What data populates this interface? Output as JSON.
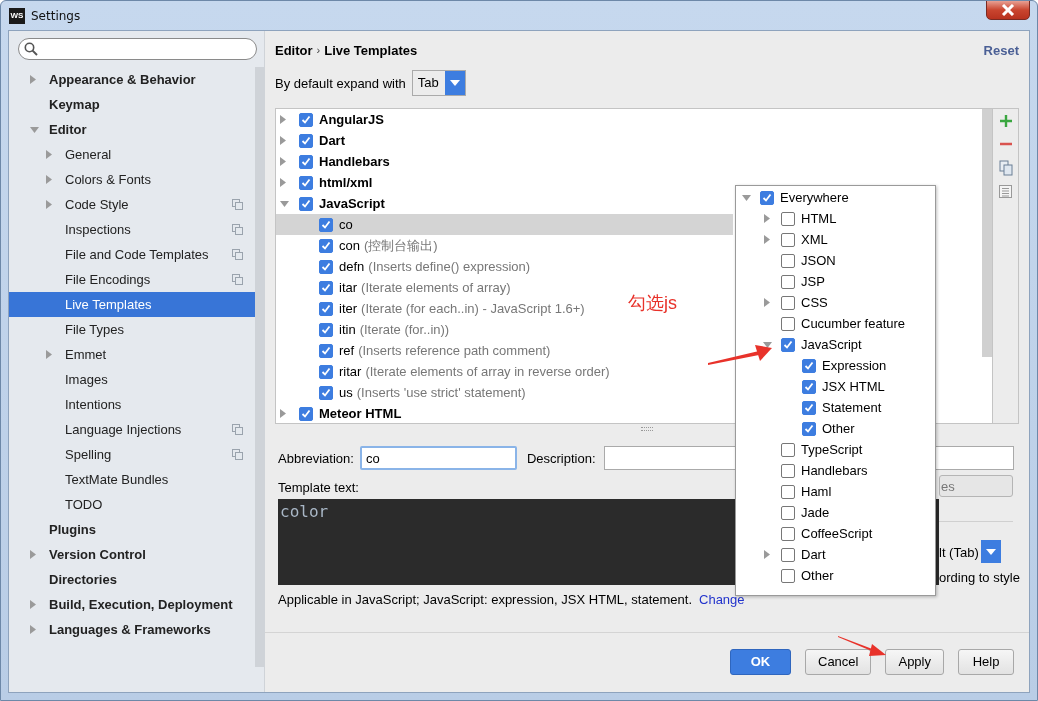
{
  "window": {
    "title": "Settings",
    "logo": "WS"
  },
  "sidebar": {
    "items": [
      {
        "label": "Appearance & Behavior",
        "expanded": false
      },
      {
        "label": "Keymap"
      },
      {
        "label": "Editor",
        "expanded": true,
        "children": [
          {
            "label": "General",
            "expanded": false
          },
          {
            "label": "Colors & Fonts",
            "expanded": false
          },
          {
            "label": "Code Style",
            "expanded": false,
            "project": true
          },
          {
            "label": "Inspections",
            "project": true
          },
          {
            "label": "File and Code Templates",
            "project": true
          },
          {
            "label": "File Encodings",
            "project": true
          },
          {
            "label": "Live Templates",
            "selected": true
          },
          {
            "label": "File Types"
          },
          {
            "label": "Emmet",
            "expanded": false
          },
          {
            "label": "Images"
          },
          {
            "label": "Intentions"
          },
          {
            "label": "Language Injections",
            "project": true
          },
          {
            "label": "Spelling",
            "project": true
          },
          {
            "label": "TextMate Bundles"
          },
          {
            "label": "TODO"
          }
        ]
      },
      {
        "label": "Plugins"
      },
      {
        "label": "Version Control",
        "expanded": false
      },
      {
        "label": "Directories"
      },
      {
        "label": "Build, Execution, Deployment",
        "expanded": false
      },
      {
        "label": "Languages & Frameworks",
        "expanded": false
      }
    ]
  },
  "header": {
    "breadcrumb": [
      "Editor",
      "Live Templates"
    ],
    "separator": "›",
    "reset": "Reset"
  },
  "expand_with": {
    "label": "By default expand with",
    "value": "Tab"
  },
  "templates": [
    {
      "name": "AngularJS",
      "checked": true,
      "expanded": false
    },
    {
      "name": "Dart",
      "checked": true,
      "expanded": false
    },
    {
      "name": "Handlebars",
      "checked": true,
      "expanded": false
    },
    {
      "name": "html/xml",
      "checked": true,
      "expanded": false
    },
    {
      "name": "JavaScript",
      "checked": true,
      "expanded": true,
      "children": [
        {
          "abbr": "co",
          "checked": true,
          "selected": true
        },
        {
          "abbr": "con",
          "description": "(控制台输出)",
          "checked": true,
          "selected": false
        },
        {
          "abbr": "defn",
          "description": "(Inserts define() expression)",
          "checked": true,
          "selected": false
        },
        {
          "abbr": "itar",
          "description": "(Iterate elements of array)",
          "checked": true,
          "selected": false
        },
        {
          "abbr": "iter",
          "description": "(Iterate (for each..in) - JavaScript 1.6+)",
          "checked": true,
          "selected": false
        },
        {
          "abbr": "itin",
          "description": "(Iterate (for..in))",
          "checked": true,
          "selected": false
        },
        {
          "abbr": "ref",
          "description": "(Inserts reference path comment)",
          "checked": true,
          "selected": false
        },
        {
          "abbr": "ritar",
          "description": "(Iterate elements of array in reverse order)",
          "checked": true,
          "selected": false
        },
        {
          "abbr": "us",
          "description": "(Inserts 'use strict' statement)",
          "checked": true,
          "selected": false
        }
      ]
    },
    {
      "name": "Meteor HTML",
      "checked": true,
      "expanded": false
    }
  ],
  "editor": {
    "abbreviation_label": "Abbreviation:",
    "abbreviation": "co",
    "description_label": "Description:",
    "template_label": "Template text:",
    "template_text": "color",
    "applicable": "Applicable in JavaScript; JavaScript: expression, JSX HTML, statement.",
    "change_link": "Change"
  },
  "options": {
    "variables_button": "es",
    "expand_dropdown": "lt (Tab)",
    "reformat_text": "ording to style"
  },
  "context_popup": {
    "items": [
      {
        "label": "Everywhere",
        "checked": true,
        "expanded": true,
        "children": [
          {
            "label": "HTML",
            "checked": false,
            "expanded": false
          },
          {
            "label": "XML",
            "checked": false,
            "expanded": false
          },
          {
            "label": "JSON",
            "checked": false
          },
          {
            "label": "JSP",
            "checked": false
          },
          {
            "label": "CSS",
            "checked": false,
            "expanded": false
          },
          {
            "label": "Cucumber feature",
            "checked": false
          },
          {
            "label": "JavaScript",
            "checked": true,
            "expanded": true,
            "children": [
              {
                "label": "Expression",
                "checked": true
              },
              {
                "label": "JSX HTML",
                "checked": true
              },
              {
                "label": "Statement",
                "checked": true
              },
              {
                "label": "Other",
                "checked": true
              }
            ]
          },
          {
            "label": "TypeScript",
            "checked": false
          },
          {
            "label": "Handlebars",
            "checked": false
          },
          {
            "label": "Haml",
            "checked": false
          },
          {
            "label": "Jade",
            "checked": false
          },
          {
            "label": "CoffeeScript",
            "checked": false
          },
          {
            "label": "Dart",
            "checked": false,
            "expanded": false
          },
          {
            "label": "Other",
            "checked": false
          }
        ]
      }
    ]
  },
  "annotation": {
    "text": "勾选js"
  },
  "buttons": [
    {
      "label": "OK",
      "kind": "default"
    },
    {
      "label": "Cancel",
      "kind": "normal"
    },
    {
      "label": "Apply",
      "kind": "normal"
    },
    {
      "label": "Help",
      "kind": "normal"
    }
  ]
}
